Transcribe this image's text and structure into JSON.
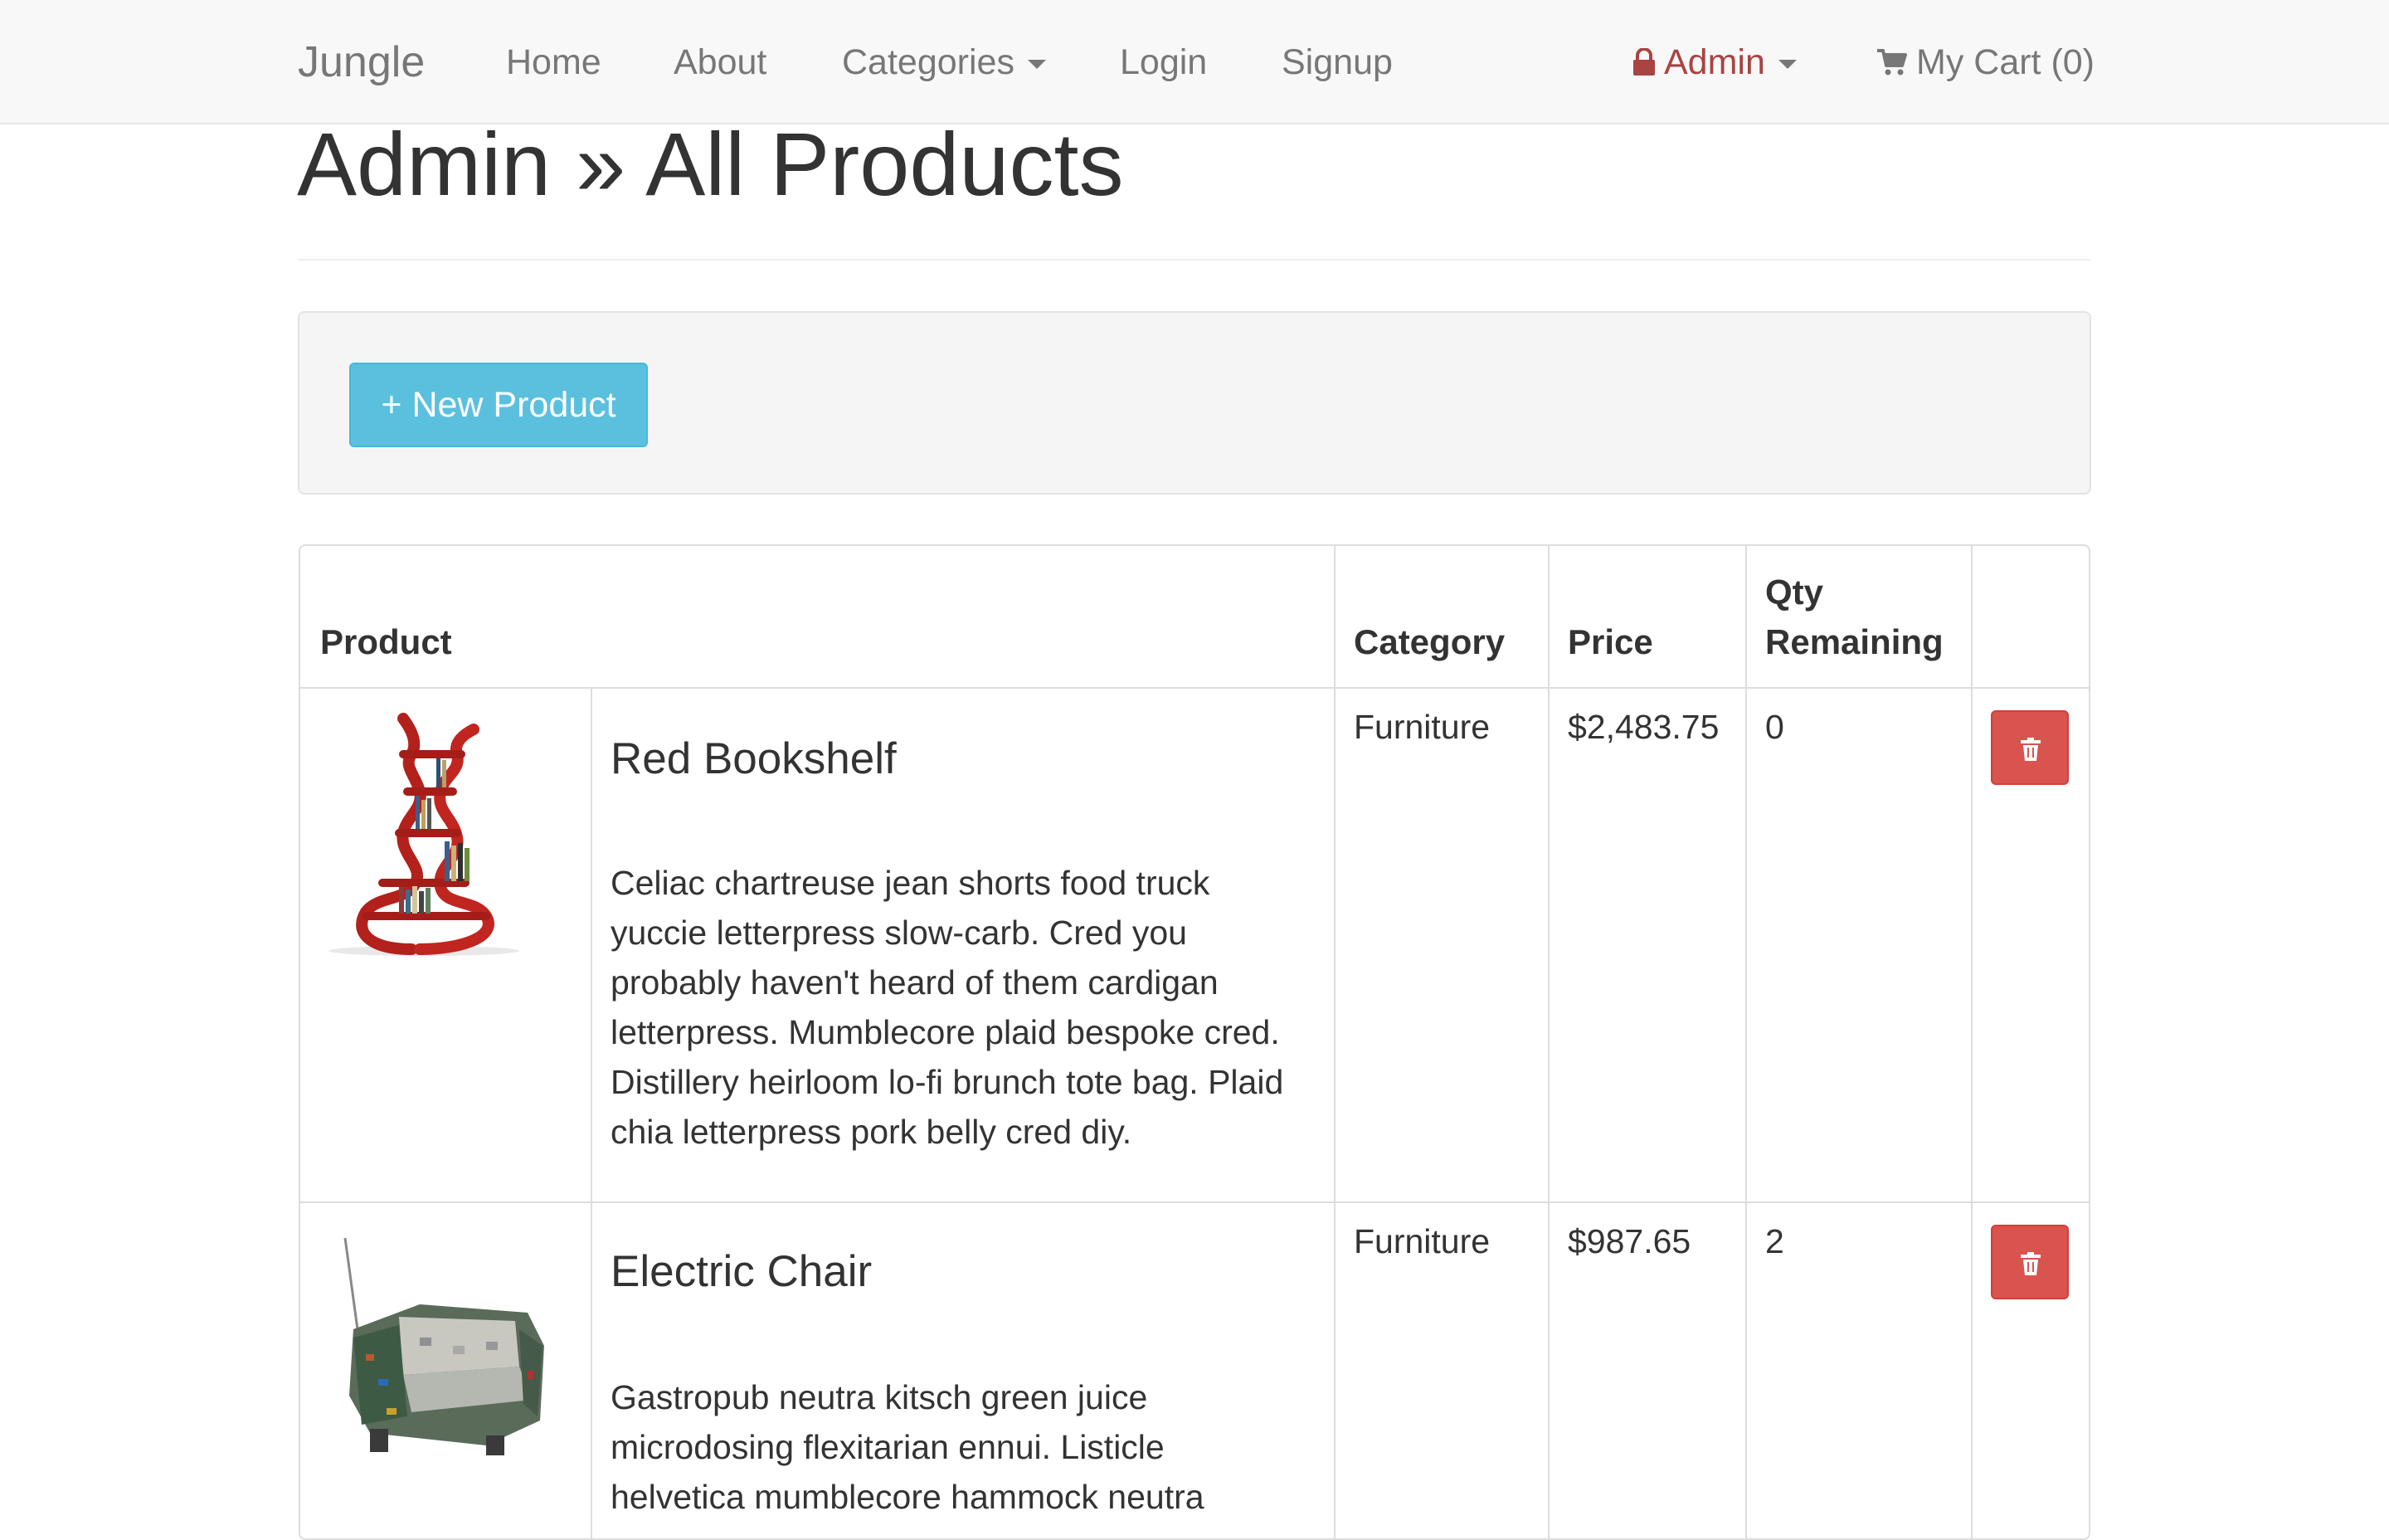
{
  "navbar": {
    "brand": "Jungle",
    "links": [
      "Home",
      "About",
      "Categories",
      "Login",
      "Signup"
    ],
    "admin_label": "Admin",
    "cart_label": "My Cart (0)",
    "icons": {
      "admin": "lock-icon",
      "cart": "shopping-cart-icon",
      "dropdown": "caret-down-icon"
    }
  },
  "page": {
    "title": "Admin » All Products"
  },
  "toolbar": {
    "new_product_label": "+ New Product"
  },
  "table": {
    "headers": {
      "product": "Product",
      "category": "Category",
      "price": "Price",
      "qty_line1": "Qty",
      "qty_line2": "Remaining"
    },
    "rows": [
      {
        "name": "Red Bookshelf",
        "description": "Celiac chartreuse jean shorts food truck yuccie letterpress slow-carb. Cred you probably haven't heard of them cardigan letterpress. Mumblecore plaid bespoke cred. Distillery heirloom lo-fi brunch tote bag. Plaid chia letterpress pork belly cred diy.",
        "category": "Furniture",
        "price": "$2,483.75",
        "qty": "0",
        "image": "red-bookshelf-image",
        "delete_icon": "trash-icon"
      },
      {
        "name": "Electric Chair",
        "description": "Gastropub neutra kitsch green juice microdosing flexitarian ennui. Listicle helvetica mumblecore hammock neutra",
        "category": "Furniture",
        "price": "$987.65",
        "qty": "2",
        "image": "electric-chair-image",
        "delete_icon": "trash-icon"
      }
    ]
  },
  "colors": {
    "navbar_bg": "#f8f8f8",
    "admin_text": "#a94442",
    "info_button": "#5bc0de",
    "danger_button": "#d9534f"
  }
}
